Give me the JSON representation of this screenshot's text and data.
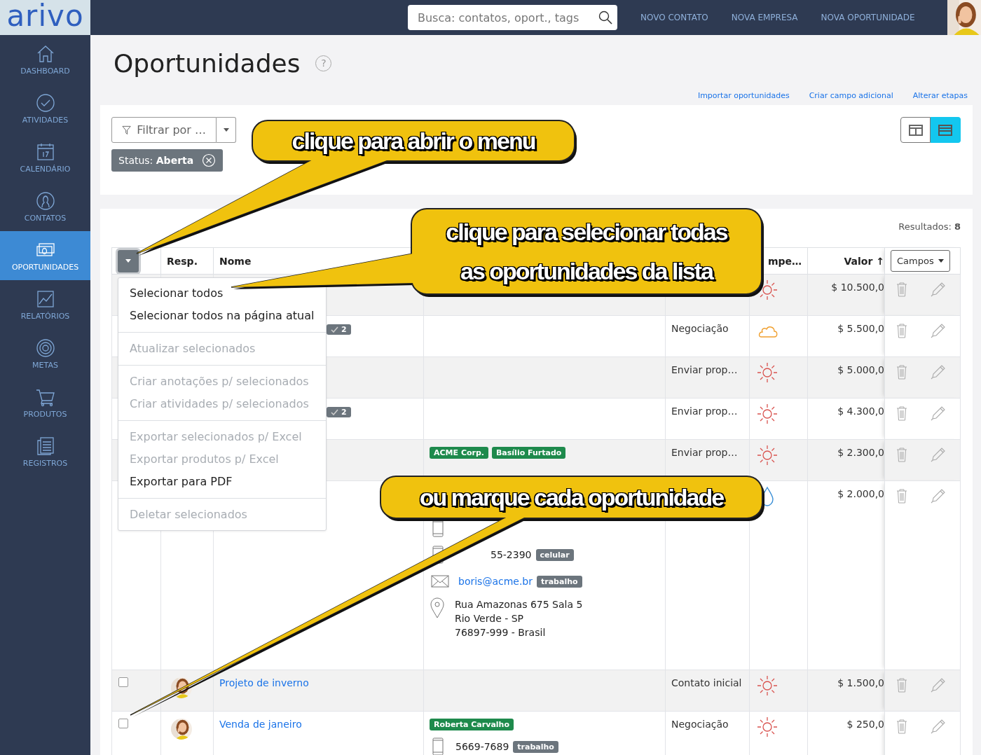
{
  "brand": {
    "logo": "arivo"
  },
  "search": {
    "placeholder": "Busca: contatos, oport., tags"
  },
  "top_links": [
    "NOVO CONTATO",
    "NOVA EMPRESA",
    "NOVA OPORTUNIDADE"
  ],
  "user": {
    "kind": "picture"
  },
  "sidebar": {
    "items": [
      {
        "label": "DASHBOARD",
        "kind": "home",
        "selected": false
      },
      {
        "label": "ATIVIDADES",
        "kind": "check",
        "selected": false
      },
      {
        "label": "CALENDÁRIO",
        "kind": "calendar",
        "selected": false
      },
      {
        "label": "CONTATOS",
        "kind": "person",
        "selected": false
      },
      {
        "label": "OPORTUNIDADES",
        "kind": "money",
        "selected": true
      },
      {
        "label": "RELATÓRIOS",
        "kind": "chart",
        "selected": false
      },
      {
        "label": "METAS",
        "kind": "target",
        "selected": false
      },
      {
        "label": "PRODUTOS",
        "kind": "cart",
        "selected": false
      },
      {
        "label": "REGISTROS",
        "kind": "ledger",
        "selected": false
      }
    ]
  },
  "page": {
    "title": "Oportunidades",
    "help": "?",
    "actions": [
      "Importar oportunidades",
      "Criar campo adicional",
      "Alterar etapas"
    ]
  },
  "filter": {
    "button": "Filtrar por …",
    "chips": [
      {
        "text": "Status: **Aberta**"
      }
    ],
    "views": [
      {
        "kind": "columns",
        "selected": false
      },
      {
        "kind": "rows",
        "selected": true
      }
    ]
  },
  "results": "Resultados: **8**",
  "table": {
    "header": {
      "resp": "Resp.",
      "nome": "Nome",
      "column_6": "mpe…",
      "valor": "Valor ↑",
      "fields_button": "Campos"
    },
    "rows": [
      {
        "temperature": {
          "kind": "hot"
        },
        "value": "$ 10.500,0"
      },
      {
        "badge": "2",
        "stage": "Negociação",
        "temperature": {
          "kind": "warm"
        },
        "value": "$ 5.500,0"
      },
      {
        "stage": "Enviar prop…",
        "temperature": {
          "kind": "hot"
        },
        "value": "$ 5.000,0"
      },
      {
        "badge": "2",
        "stage": "Enviar prop…",
        "temperature": {
          "kind": "hot"
        },
        "value": "$ 4.300,0"
      },
      {
        "tags": [
          "ACME Corp.",
          "Basílio Furtado"
        ],
        "stage": "Enviar prop…",
        "temperature": {
          "kind": "hot"
        },
        "value": "$ 2.300,0"
      },
      {
        "contacts": [
          {
            "kind": "phone"
          },
          {
            "kind": "phone",
            "text": "55-2390",
            "tag": "celular"
          },
          {
            "kind": "email",
            "text": "boris@acme.br",
            "tag": "trabalho"
          },
          {
            "kind": "address",
            "lines": [
              "Rua Amazonas 675 Sala 5",
              "Rio Verde - SP",
              "76897-999 - Brasil"
            ]
          }
        ],
        "temperature": {
          "kind": "cold"
        },
        "value": "$ 2.000,0"
      },
      {
        "checked": false,
        "owner": {
          "kind": "picture"
        },
        "name": "Projeto de inverno",
        "stage": "Contato inicial",
        "temperature": {
          "kind": "hot"
        },
        "value": "$ 1.500,0"
      },
      {
        "checked": false,
        "owner": {
          "kind": "picture"
        },
        "name": "Venda de janeiro",
        "tags": [
          "Roberta Carvalho"
        ],
        "contacts": [
          {
            "kind": "phone",
            "text": "5669-7689",
            "tag": "trabalho"
          }
        ],
        "stage": "Negociação",
        "temperature": {
          "kind": "hot"
        },
        "value": "$ 250,0"
      }
    ]
  },
  "bulk_menu": {
    "groups": [
      [
        {
          "label": "Selecionar todos",
          "disabled": false
        },
        {
          "label": "Selecionar todos na página atual",
          "disabled": false
        }
      ],
      [
        {
          "label": "Atualizar selecionados",
          "disabled": true
        }
      ],
      [
        {
          "label": "Criar anotações p/ selecionados",
          "disabled": true
        },
        {
          "label": "Criar atividades p/ selecionados",
          "disabled": true
        }
      ],
      [
        {
          "label": "Exportar selecionados p/ Excel",
          "disabled": true
        },
        {
          "label": "Exportar produtos p/ Excel",
          "disabled": true
        },
        {
          "label": "Exportar para PDF",
          "disabled": false
        }
      ],
      [
        {
          "label": "Deletar selecionados",
          "disabled": true
        }
      ]
    ]
  },
  "callouts": [
    {
      "lines": [
        "clique para abrir o menu"
      ]
    },
    {
      "lines": [
        "clique para selecionar todas",
        "as oportunidades da lista"
      ]
    },
    {
      "lines": [
        "ou marque cada oportunidade"
      ]
    }
  ]
}
